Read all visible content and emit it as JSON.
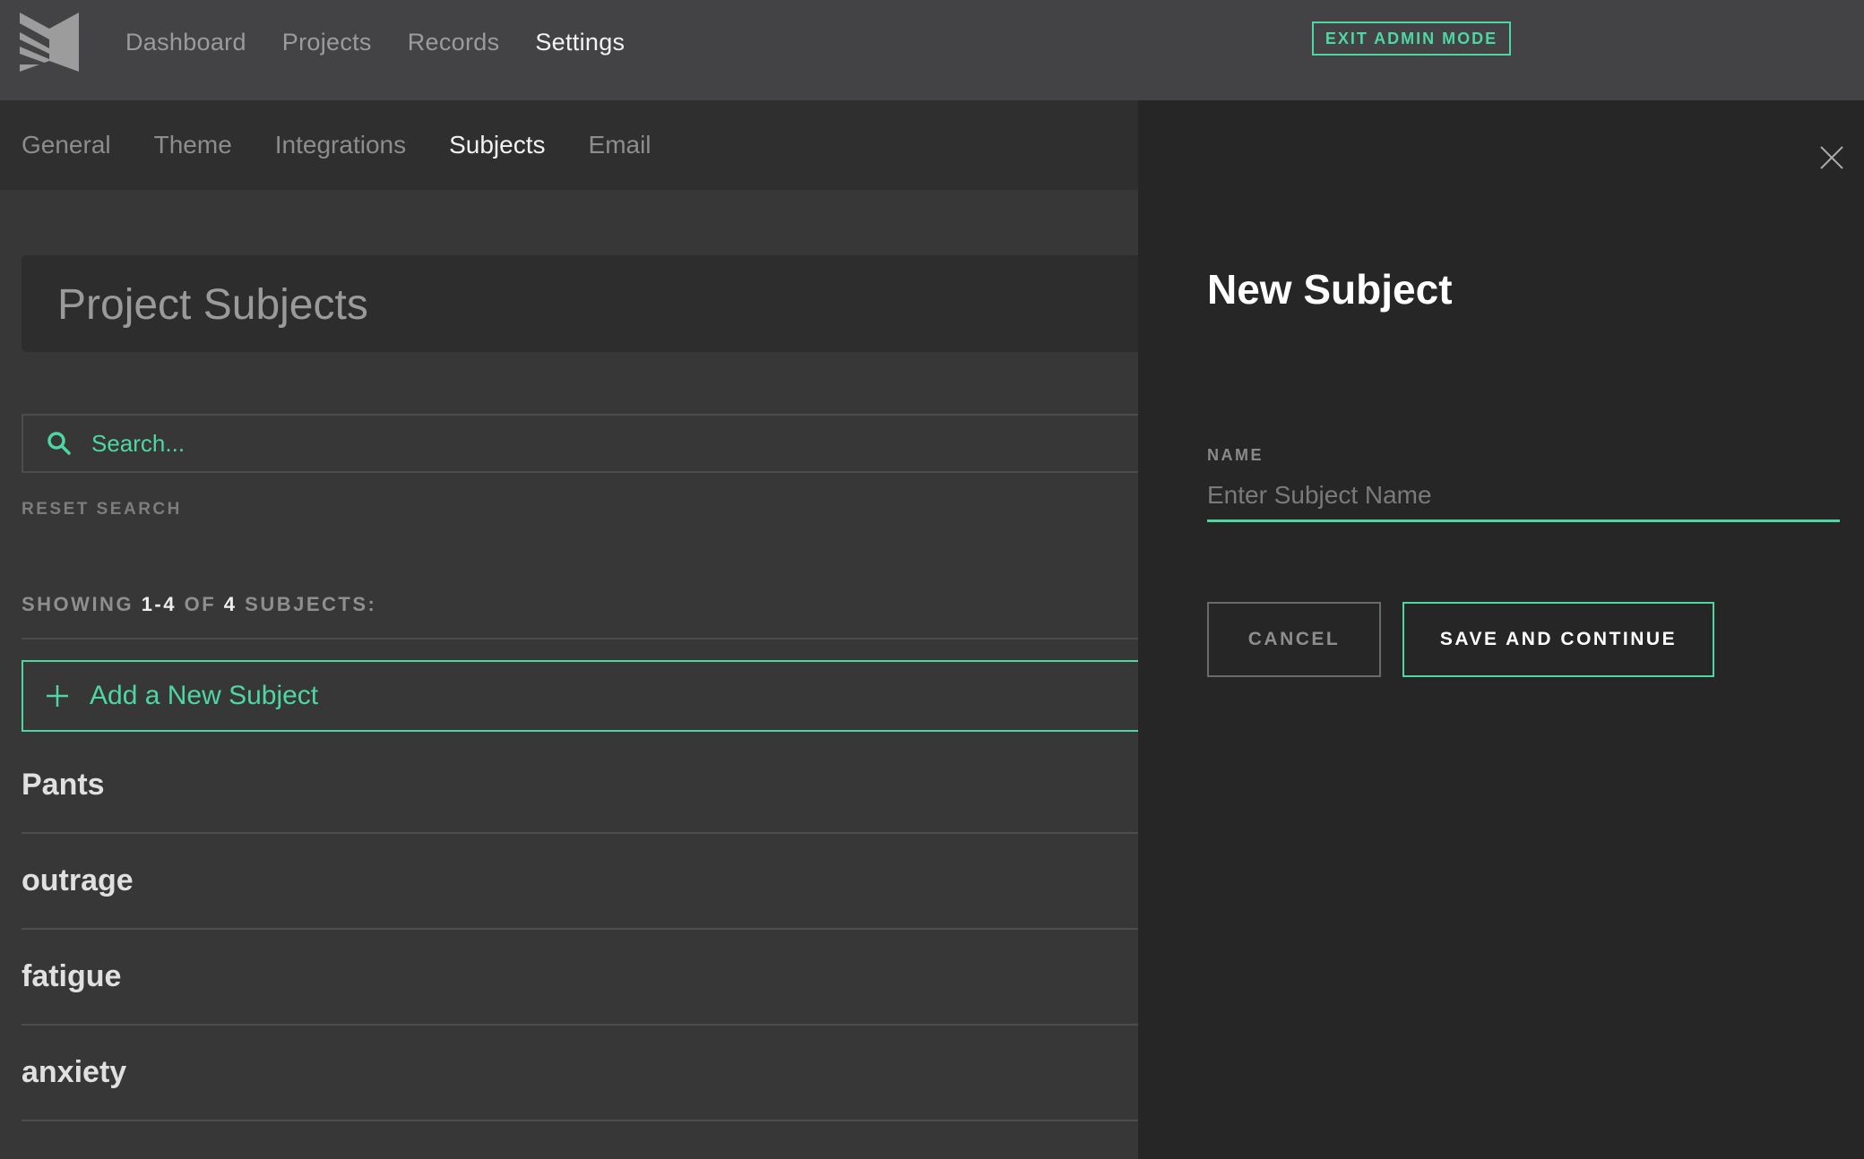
{
  "nav": {
    "items": [
      {
        "label": "Dashboard",
        "active": false
      },
      {
        "label": "Projects",
        "active": false
      },
      {
        "label": "Records",
        "active": false
      },
      {
        "label": "Settings",
        "active": true
      }
    ],
    "exit_admin_label": "EXIT ADMIN MODE"
  },
  "subnav": {
    "tabs": [
      {
        "label": "General",
        "active": false
      },
      {
        "label": "Theme",
        "active": false
      },
      {
        "label": "Integrations",
        "active": false
      },
      {
        "label": "Subjects",
        "active": true
      },
      {
        "label": "Email",
        "active": false
      }
    ]
  },
  "main": {
    "title": "Project Subjects",
    "search_placeholder": "Search...",
    "reset_label": "RESET SEARCH",
    "showing": {
      "prefix": "SHOWING",
      "range": "1-4",
      "of": "OF",
      "total": "4",
      "suffix": "SUBJECTS:"
    },
    "add_label": "Add a New Subject",
    "subjects": [
      "Pants",
      "outrage",
      "fatigue",
      "anxiety"
    ]
  },
  "panel": {
    "title": "New Subject",
    "field_label": "NAME",
    "field_placeholder": "Enter Subject Name",
    "cancel_label": "CANCEL",
    "save_label": "SAVE AND CONTINUE"
  },
  "colors": {
    "accent": "#4ed6a3",
    "topbar": "#434345",
    "panel": "#262626"
  },
  "icons": {
    "logo": "logo-icon",
    "search": "search-icon",
    "add": "plus-icon",
    "close": "close-icon"
  }
}
